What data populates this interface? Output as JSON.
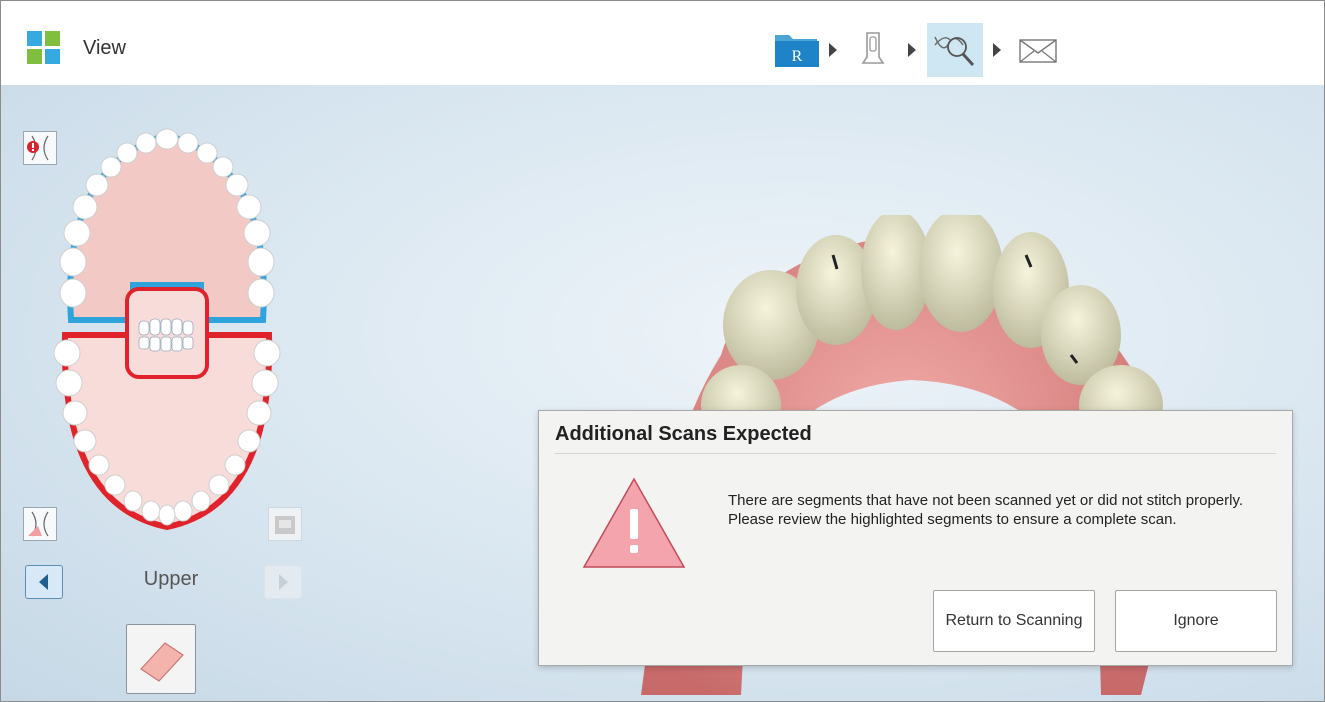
{
  "header": {
    "title": "View",
    "workflow": [
      {
        "name": "rx",
        "icon": "rx-folder-icon",
        "label": "R",
        "active": false
      },
      {
        "name": "scan",
        "icon": "scanner-wand-icon",
        "active": false
      },
      {
        "name": "view",
        "icon": "view-scan-icon",
        "active": true
      },
      {
        "name": "send",
        "icon": "envelope-icon",
        "active": false
      }
    ]
  },
  "left_panel": {
    "jaw_label": "Upper"
  },
  "dialog": {
    "title": "Additional Scans Expected",
    "message": "There are segments that have not been scanned yet or did not stitch properly. Please review the highlighted segments to ensure a complete scan.",
    "return_label": "Return to Scanning",
    "ignore_label": "Ignore"
  },
  "colors": {
    "upper_arch": "#2fa4dc",
    "lower_arch": "#e0232b",
    "active_step": "#cfe6f3",
    "warning": "#f4a4ac"
  }
}
